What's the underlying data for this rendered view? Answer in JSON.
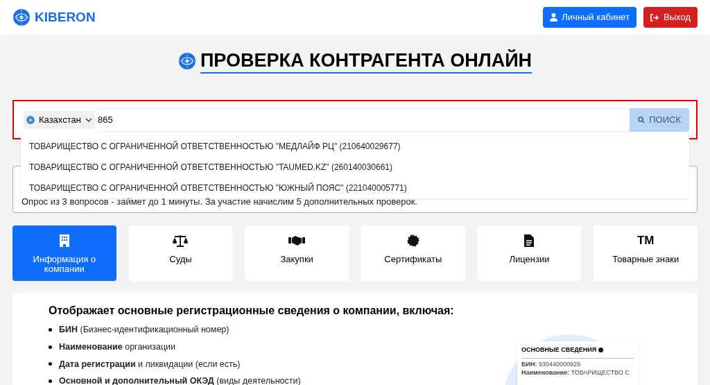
{
  "header": {
    "logo": "KIBERON",
    "buttons": [
      {
        "kind": "account",
        "label": "Личный кабинет"
      },
      {
        "kind": "logout",
        "label": "Выход"
      }
    ]
  },
  "title": "ПРОВЕРКА КОНТРАГЕНТА ОНЛАЙН",
  "search": {
    "country": "Казахстан",
    "value": "865",
    "button": "ПОИСК"
  },
  "suggestions": [
    "ТОВАРИЩЕСТВО С ОГРАНИЧЕННОЙ ОТВЕТСТВЕННОСТЬЮ \"МЕДЛАЙФ РЦ\" (210640029677)",
    "ТОВАРИЩЕСТВО С ОГРАНИЧЕННОЙ ОТВЕТСТВЕННОСТЬЮ \"TAUMED.KZ\" (260140030661)",
    "ТОВАРИЩЕСТВО С ОГРАНИЧЕННОЙ ОТВЕТСТВЕННОСТЬЮ \"ЮЖНЫЙ ПОЯС\" (221040005771)"
  ],
  "banner": {
    "text": "Опрос из 3 вопросов - займет до 1 минуты. За участие начислим 5 дополнительных проверок."
  },
  "tabs": [
    {
      "kind": "building",
      "label": "Информация о компании",
      "selected": true
    },
    {
      "kind": "scales",
      "label": "Суды",
      "selected": false
    },
    {
      "kind": "handshake",
      "label": "Закупки",
      "selected": false
    },
    {
      "kind": "badge",
      "label": "Сертификаты",
      "selected": false
    },
    {
      "kind": "document",
      "label": "Лицензии",
      "selected": false
    },
    {
      "kind": "trademark",
      "icon_text": "TM",
      "label": "Товарные знаки",
      "selected": false
    }
  ],
  "content": {
    "heading": "Отображает основные регистрационные сведения о компании, включая:",
    "items": [
      "**БИН** (Бизнес-идентификационный номер)",
      "**Наименование** организации",
      "**Дата регистрации** и ликвидации (если есть)",
      "**Основной и дополнительный ОКЭД** (виды деятельности)"
    ],
    "preview": {
      "title": "ОСНОВНЫЕ СВЕДЕНИЯ",
      "lines": [
        "**БИН:** 930440000929",
        "**Наименование:** ТОВАРИЩЕСТВО С"
      ]
    }
  }
}
